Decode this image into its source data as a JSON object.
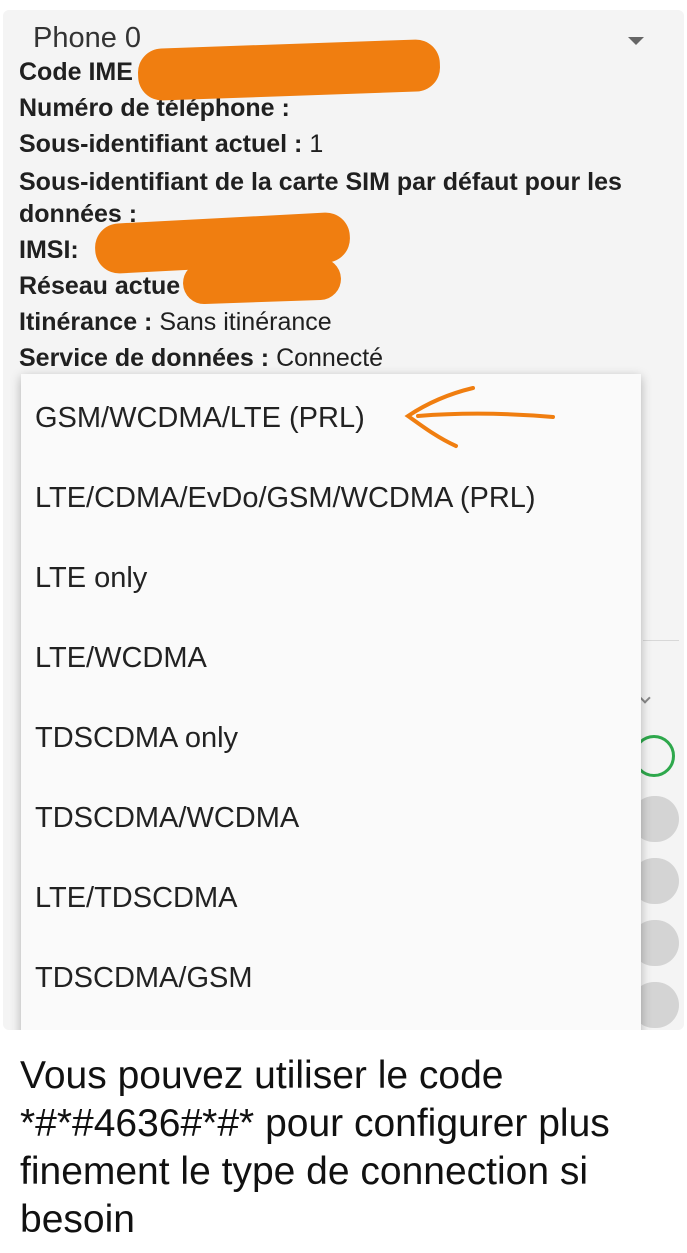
{
  "screen": {
    "phone_select": "Phone 0",
    "info": {
      "imei_label": "Code IME",
      "phone_number_label": "Numéro de téléphone :",
      "sub_id_label": "Sous-identifiant actuel :",
      "sub_id_value": "1",
      "default_sim_label_1": "Sous-identifiant de la carte SIM par défaut pour les",
      "default_sim_label_2": "données :",
      "imsi_label": "IMSI:",
      "network_label": "Réseau actue",
      "roaming_label": "Itinérance :",
      "roaming_value": "Sans itinérance",
      "data_service_label": "Service de données :",
      "data_service_value": "Connecté"
    },
    "network_type_options": [
      "GSM/WCDMA/LTE (PRL)",
      "LTE/CDMA/EvDo/GSM/WCDMA (PRL)",
      "LTE only",
      "LTE/WCDMA",
      "TDSCDMA only",
      "TDSCDMA/WCDMA",
      "LTE/TDSCDMA",
      "TDSCDMA/GSM"
    ],
    "selected_option": "GSM/WCDMA/LTE (PRL)"
  },
  "caption": "Vous pouvez utiliser le code *#*#4636#*#* pour configurer plus finement le type de connection si besoin",
  "colors": {
    "annotation": "#f07e10",
    "switch_on": "#2ea84c"
  }
}
